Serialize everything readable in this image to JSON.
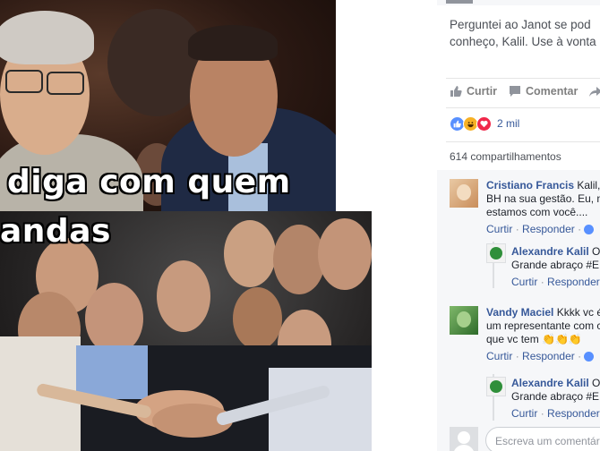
{
  "meme": {
    "caption_line1": "diga com quem",
    "caption_line2": "andas"
  },
  "post": {
    "text_line1": "Perguntei ao Janot se pod",
    "text_line2": "conheço, Kalil. Use à vonta"
  },
  "actions": {
    "like_label": "Curtir",
    "comment_label": "Comentar",
    "share_label": ""
  },
  "reactions": {
    "icons": [
      "like-icon",
      "haha-icon",
      "love-icon"
    ],
    "count": "2 mil",
    "colors": {
      "like": "#5890ff",
      "haha": "#f7b125",
      "love": "#f0284a"
    }
  },
  "shares": "614 compartilhamentos",
  "comments": [
    {
      "author": "Cristiano Francis",
      "line1": "Kalil,",
      "line2": "BH na sua gestão. Eu, n",
      "line3": "estamos com você....",
      "actions": [
        "Curtir",
        "Responder"
      ],
      "replies": [
        {
          "author": "Alexandre Kalil",
          "line1": "O",
          "line2": "Grande abraço #E",
          "actions": [
            "Curtir",
            "Responder"
          ]
        }
      ]
    },
    {
      "author": "Vandy Maciel",
      "line1": "Kkkk vc é",
      "line2": "um representante com c",
      "line3": "que vc tem",
      "actions": [
        "Curtir",
        "Responder"
      ],
      "replies": [
        {
          "author": "Alexandre Kalil",
          "line1": "O",
          "line2": "Grande abraço #E",
          "actions": [
            "Curtir",
            "Responder"
          ]
        }
      ]
    }
  ],
  "comment_input": {
    "placeholder": "Escreva um comentário"
  },
  "colors": {
    "link": "#365899",
    "accent": "#4267b2"
  }
}
